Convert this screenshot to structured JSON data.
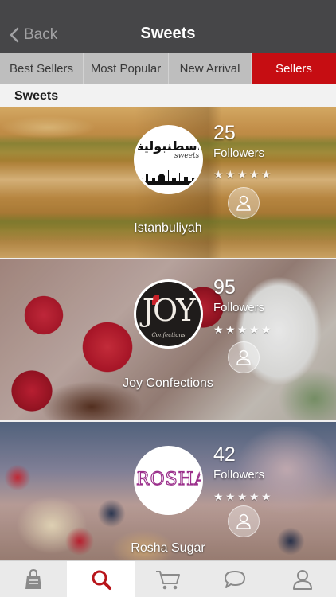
{
  "nav": {
    "back_label": "Back",
    "title": "Sweets"
  },
  "tabs": [
    {
      "label": "Best Sellers",
      "active": false
    },
    {
      "label": "Most Popular",
      "active": false
    },
    {
      "label": "New Arrival",
      "active": false
    },
    {
      "label": "Sellers",
      "active": true
    }
  ],
  "section": {
    "title": "Sweets"
  },
  "sellers": [
    {
      "name": "Istanbuliyah",
      "followers": "25",
      "followers_label": "Followers",
      "rating": 0,
      "logo_text": "اسطنبولية",
      "logo_sub": "sweets"
    },
    {
      "name": "Joy Confections",
      "followers": "95",
      "followers_label": "Followers",
      "rating": 2,
      "logo_text": "JOY",
      "logo_sub": "Confections"
    },
    {
      "name": "Rosha Sugar",
      "followers": "42",
      "followers_label": "Followers",
      "rating": 1,
      "logo_text": "ROSHA'S"
    }
  ],
  "tabbar": {
    "items": [
      {
        "icon": "shopping-bag-icon",
        "active": false
      },
      {
        "icon": "search-icon",
        "active": true
      },
      {
        "icon": "cart-icon",
        "active": false
      },
      {
        "icon": "chat-bubble-icon",
        "active": false
      },
      {
        "icon": "profile-icon",
        "active": false
      }
    ],
    "active_color": "#b8141a",
    "inactive_color": "#8a8a8a"
  },
  "colors": {
    "navbar": "#464648",
    "active_tab": "#c60d12"
  }
}
